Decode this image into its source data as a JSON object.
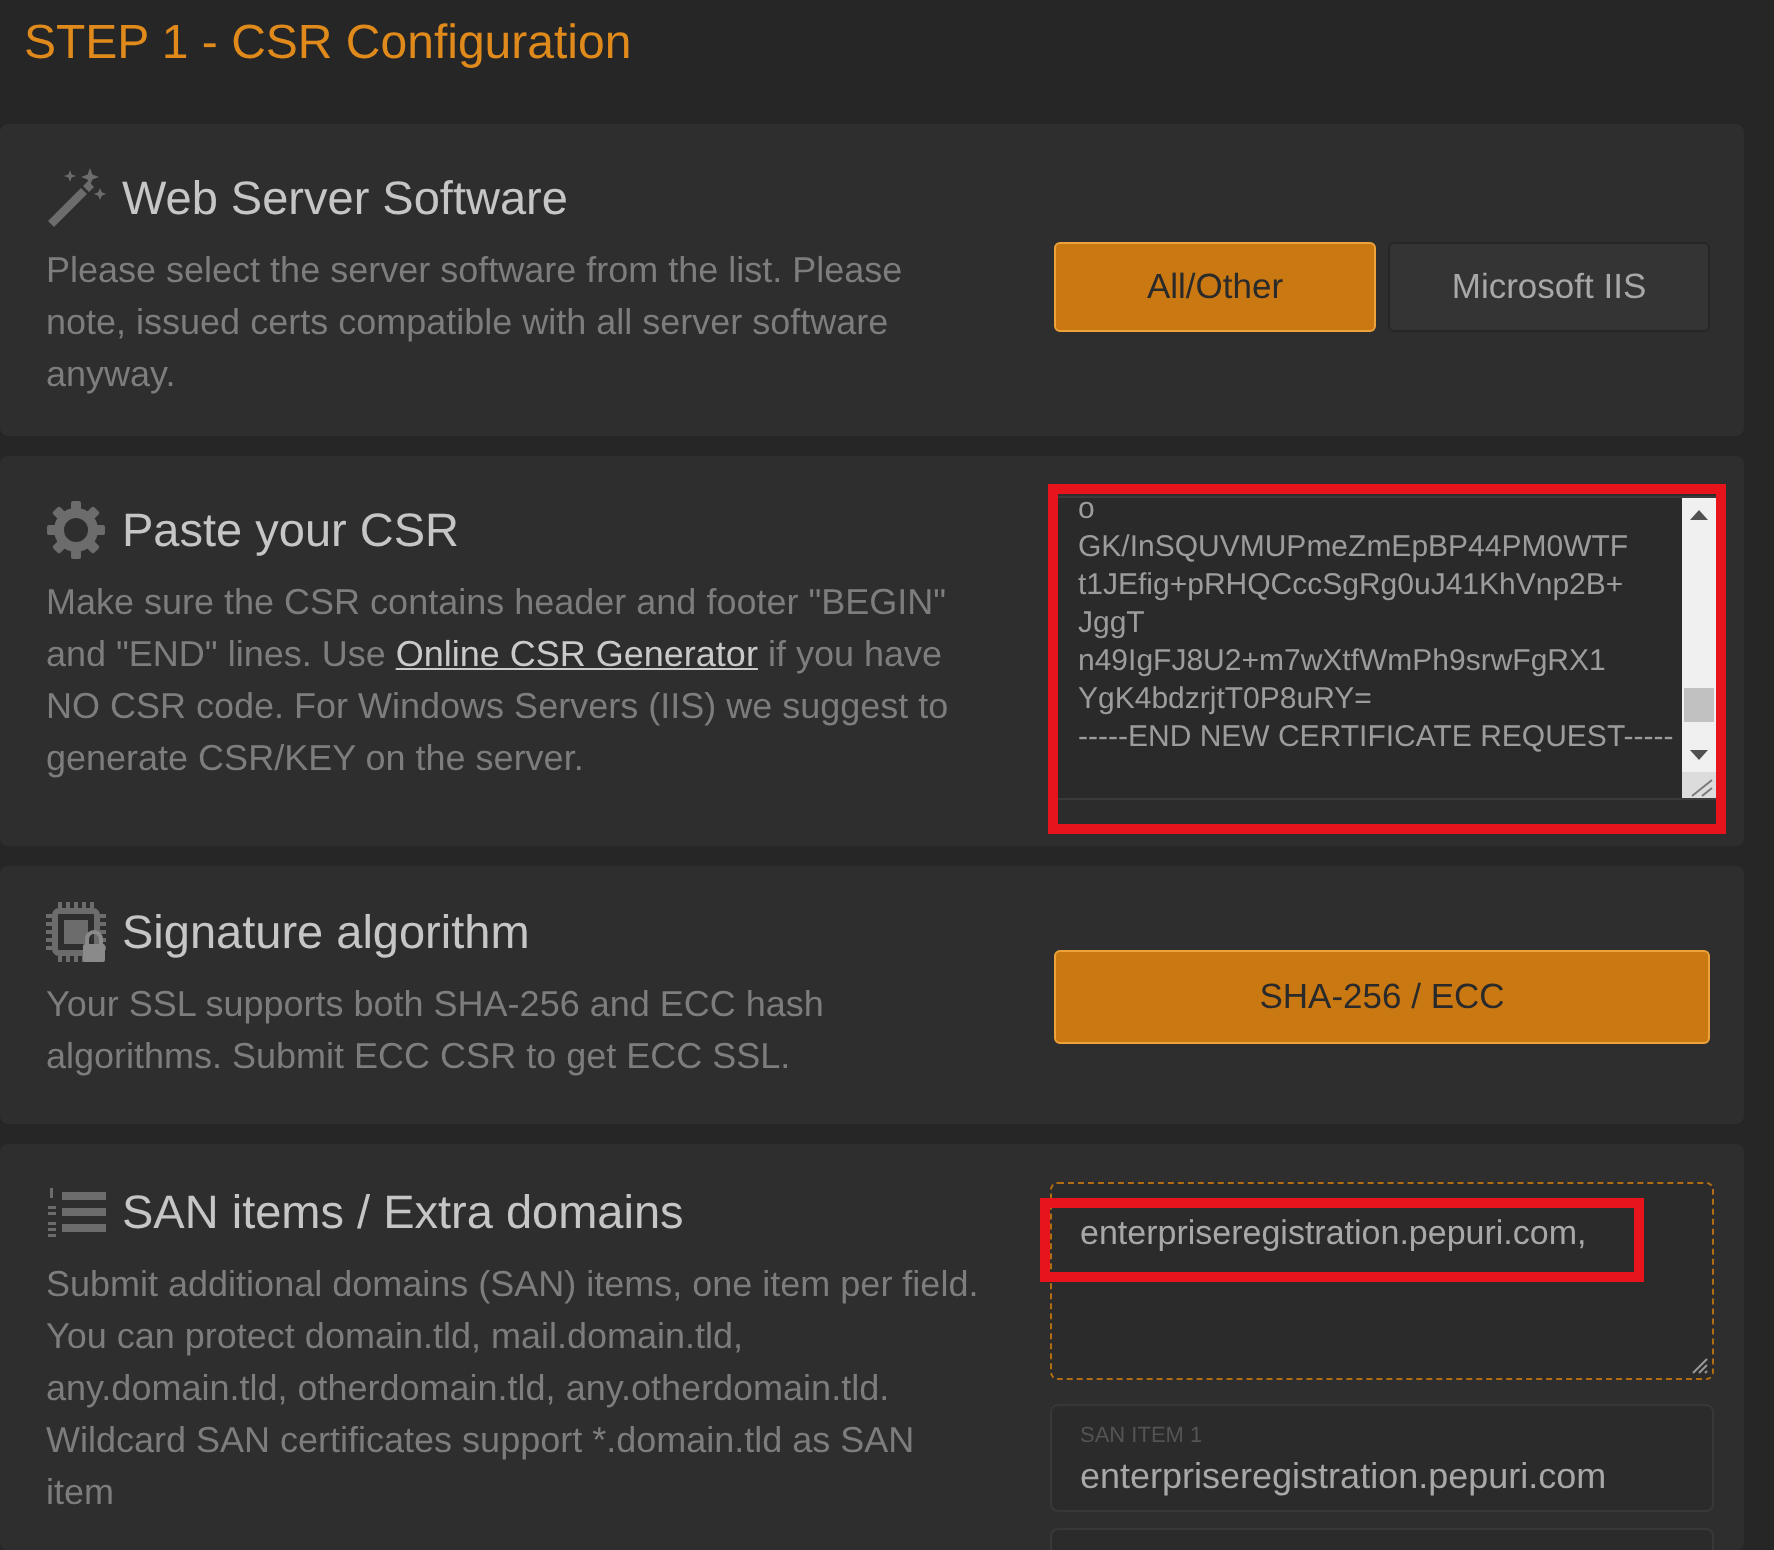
{
  "title": "STEP 1 - CSR Configuration",
  "sections": [
    {
      "kind": "server_software",
      "heading": "Web Server Software",
      "description": [
        {
          "kind": "text",
          "text": "Please select the server software from the list. Please note, issued certs compatible with all server software anyway."
        }
      ],
      "options": [
        {
          "label": "All/Other",
          "selected": true
        },
        {
          "label": "Microsoft IIS",
          "selected": false
        }
      ]
    },
    {
      "kind": "csr",
      "heading": "Paste your CSR",
      "description": [
        {
          "kind": "text",
          "text": "Make sure the CSR contains header and footer \"BEGIN\" and \"END\" lines. Use "
        },
        {
          "kind": "link",
          "text": "Online CSR Generator"
        },
        {
          "kind": "text",
          "text": " if you have NO CSR code. For Windows Servers (IIS) we suggest to generate CSR/KEY on the server."
        }
      ],
      "csr_field": {
        "value": "o\nGK/InSQUVMUPmeZmEpBP44PM0WTF\nt1JEfig+pRHQCccSgRg0uJ41KhVnp2B+\nJggT\nn49IgFJ8U2+m7wXtfWmPh9srwFgRX1\nYgK4bdzrjtT0P8uRY=\n-----END NEW CERTIFICATE REQUEST-----",
        "highlighted": true
      }
    },
    {
      "kind": "signature",
      "heading": "Signature algorithm",
      "description": [
        {
          "kind": "text",
          "text": "Your SSL supports both SHA-256 and ECC hash algorithms. Submit ECC CSR to get ECC SSL."
        }
      ],
      "options": [
        {
          "label": "SHA-256 / ECC",
          "selected": true
        }
      ]
    },
    {
      "kind": "san_items",
      "heading": "SAN items / Extra domains",
      "description": [
        {
          "kind": "text",
          "text": "Submit additional domains (SAN) items, one item per field. You can protect domain.tld, mail.domain.tld, any.domain.tld, otherdomain.tld, any.otherdomain.tld. Wildcard SAN certificates support *.domain.tld as SAN item"
        }
      ],
      "san_field": {
        "value": "enterpriseregistration.pepuri.com,",
        "highlighted": true
      },
      "san_items": [
        {
          "label": "SAN ITEM 1",
          "value": "enterpriseregistration.pepuri.com"
        }
      ]
    }
  ]
}
